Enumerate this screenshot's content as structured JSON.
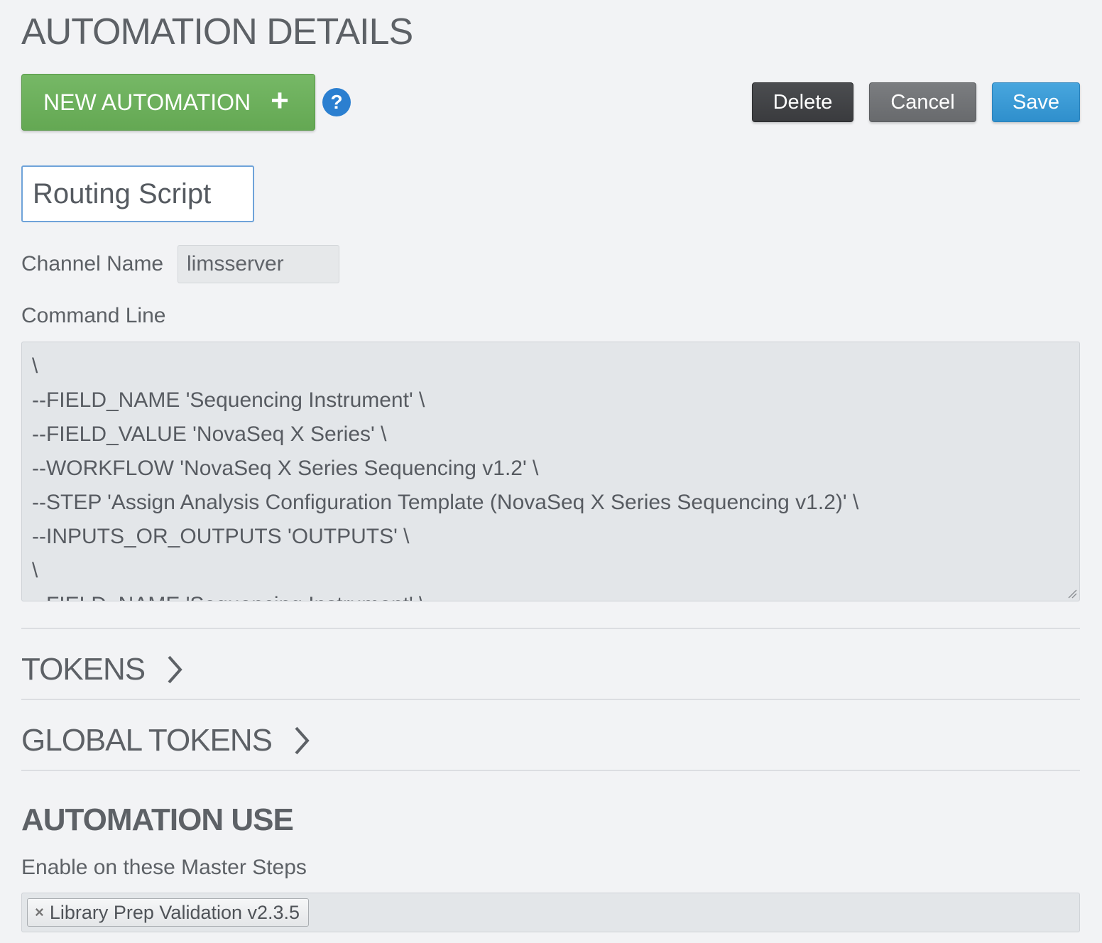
{
  "page": {
    "title": "AUTOMATION DETAILS"
  },
  "toolbar": {
    "new_automation_label": "NEW AUTOMATION",
    "new_automation_icon": "plus-icon",
    "help_icon": "question-icon",
    "help_symbol": "?",
    "delete_label": "Delete",
    "cancel_label": "Cancel",
    "save_label": "Save"
  },
  "form": {
    "automation_name": "Routing Script",
    "channel_label": "Channel Name",
    "channel_value": "limsserver",
    "command_label": "Command Line",
    "command_lines": [
      "\\",
      "--FIELD_NAME 'Sequencing Instrument' \\",
      "--FIELD_VALUE 'NovaSeq X Series' \\",
      "--WORKFLOW 'NovaSeq X Series Sequencing v1.2' \\",
      "--STEP 'Assign Analysis Configuration Template (NovaSeq X Series Sequencing v1.2)' \\",
      "--INPUTS_OR_OUTPUTS 'OUTPUTS' \\",
      "\\",
      "--FIELD_NAME 'Sequencing Instrument' \\"
    ]
  },
  "sections": {
    "tokens_label": "TOKENS",
    "global_tokens_label": "GLOBAL TOKENS"
  },
  "usage": {
    "title": "AUTOMATION USE",
    "steps_label": "Enable on these Master Steps",
    "steps": [
      "Library Prep Validation v2.3.5"
    ]
  },
  "colors": {
    "new_button": "#6aae58",
    "delete_button": "#424447",
    "cancel_button": "#727477",
    "save_button": "#3a9ad5",
    "help_icon": "#2b7fd0"
  }
}
